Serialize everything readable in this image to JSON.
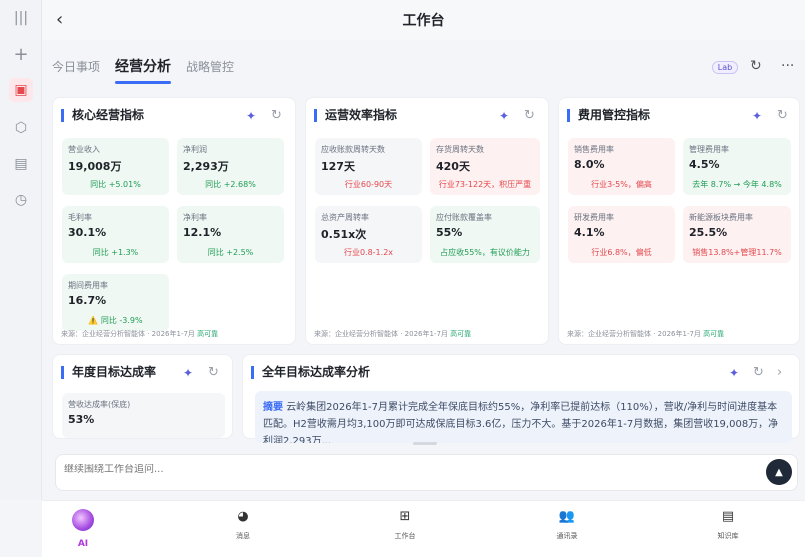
{
  "header": {
    "back_icon": "chevron-left-icon",
    "title": "工作台"
  },
  "tabs": [
    {
      "label": "今日事项"
    },
    {
      "label": "经营分析"
    },
    {
      "label": "战略管控"
    }
  ],
  "toolbar": {
    "lab_label": "Lab"
  },
  "cards": {
    "core": {
      "title": "核心经营指标",
      "tiles": [
        {
          "label": "营业收入",
          "value": "19,008万",
          "sub": "同比 +5.01%"
        },
        {
          "label": "净利润",
          "value": "2,293万",
          "sub": "同比 +2.68%"
        },
        {
          "label": "毛利率",
          "value": "30.1%",
          "sub": "同比 +1.3%"
        },
        {
          "label": "净利率",
          "value": "12.1%",
          "sub": "同比 +2.5%"
        },
        {
          "label": "期间费用率",
          "value": "16.7%",
          "sub": "⚠️ 同比 -3.9%"
        }
      ],
      "source": "来源：企业经营分析智能体 · 2026年1-7月",
      "trust": "高可靠"
    },
    "ops": {
      "title": "运营效率指标",
      "tiles": [
        {
          "label": "应收账款周转天数",
          "value": "127天",
          "sub": "行业60-90天"
        },
        {
          "label": "存货周转天数",
          "value": "420天",
          "sub": "行业73-122天，积压严重"
        },
        {
          "label": "总资产周转率",
          "value": "0.51x次",
          "sub": "行业0.8-1.2x"
        },
        {
          "label": "应付账款覆盖率",
          "value": "55%",
          "sub": "占应收55%，有议价能力"
        }
      ],
      "source": "来源：企业经营分析智能体 · 2026年1-7月",
      "trust": "高可靠"
    },
    "cost": {
      "title": "费用管控指标",
      "tiles": [
        {
          "label": "销售费用率",
          "value": "8.0%",
          "sub": "行业3-5%，偏高"
        },
        {
          "label": "管理费用率",
          "value": "4.5%",
          "sub": "去年 8.7% → 今年 4.8%"
        },
        {
          "label": "研发费用率",
          "value": "4.1%",
          "sub": "行业6.8%，偏低"
        },
        {
          "label": "新能源板块费用率",
          "value": "25.5%",
          "sub": "销售13.8%+管理11.7%"
        }
      ],
      "source": "来源：企业经营分析智能体 · 2026年1-7月",
      "trust": "高可靠"
    },
    "annual": {
      "title": "年度目标达成率",
      "tiles": [
        {
          "label": "营收达成率(保底)",
          "value": "53%"
        }
      ]
    },
    "fullyear": {
      "title": "全年目标达成率分析",
      "summary_kw": "摘要",
      "summary_text": "云岭集团2026年1-7月累计完成全年保底目标约55%，净利率已提前达标（110%），营收/净利与时间进度基本匹配。H2营收需月均3,100万即可达成保底目标3.6亿，压力不大。基于2026年1-7月数据，集团营收19,008万，净利润2,293万..."
    }
  },
  "input": {
    "placeholder": "继续围绕工作台追问..."
  },
  "bottom_nav": [
    {
      "label": "AI",
      "icon": "ai-orb-icon"
    },
    {
      "label": "消息",
      "icon": "message-icon"
    },
    {
      "label": "工作台",
      "icon": "workbench-icon"
    },
    {
      "label": "通讯录",
      "icon": "contacts-icon"
    },
    {
      "label": "知识库",
      "icon": "knowledge-icon"
    }
  ],
  "colors": {
    "accent": "#3b6cf6",
    "positive": "#1f9d55",
    "negative": "#e5484d",
    "ai": "#b039e0"
  }
}
